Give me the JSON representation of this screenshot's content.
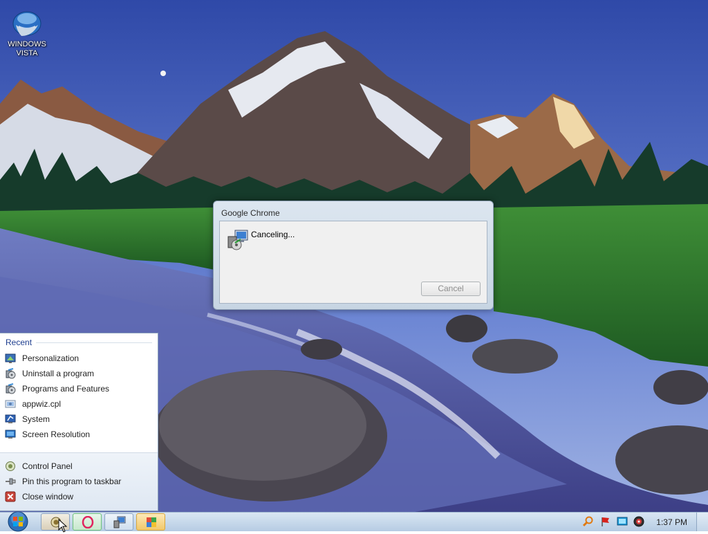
{
  "desktop": {
    "icons": [
      {
        "label_line1": "WINDOWS",
        "label_line2": "VISTA",
        "icon": "windows-vista-globe-icon"
      }
    ]
  },
  "dialog": {
    "title": "Google Chrome",
    "message": "Canceling...",
    "cancel_label": "Cancel",
    "icon": "installer-computer-icon"
  },
  "jumplist": {
    "recent_title": "Recent",
    "recent_items": [
      {
        "label": "Personalization",
        "icon": "personalization-icon"
      },
      {
        "label": "Uninstall a program",
        "icon": "uninstall-program-icon"
      },
      {
        "label": "Programs and Features",
        "icon": "programs-features-icon"
      },
      {
        "label": "appwiz.cpl",
        "icon": "cpl-file-icon"
      },
      {
        "label": "System",
        "icon": "system-icon"
      },
      {
        "label": "Screen Resolution",
        "icon": "screen-resolution-icon"
      }
    ],
    "tasks": [
      {
        "label": "Control Panel",
        "icon": "control-panel-icon"
      },
      {
        "label": "Pin this program to taskbar",
        "icon": "pin-icon"
      },
      {
        "label": "Close window",
        "icon": "close-window-icon"
      }
    ]
  },
  "taskbar": {
    "clock": "1:37 PM",
    "buttons": [
      {
        "icon": "control-panel-icon"
      },
      {
        "icon": "opera-icon"
      },
      {
        "icon": "installer-icon"
      },
      {
        "icon": "puzzle-icon"
      }
    ],
    "tray": [
      {
        "icon": "search-magnifier-icon"
      },
      {
        "icon": "action-center-flag-icon"
      },
      {
        "icon": "display-icon"
      },
      {
        "icon": "volume-icon"
      }
    ]
  },
  "colors": {
    "accent_blue": "#1e3e8f",
    "taskbar_top": "#d9e6f3",
    "taskbar_bottom": "#b6cce3"
  }
}
